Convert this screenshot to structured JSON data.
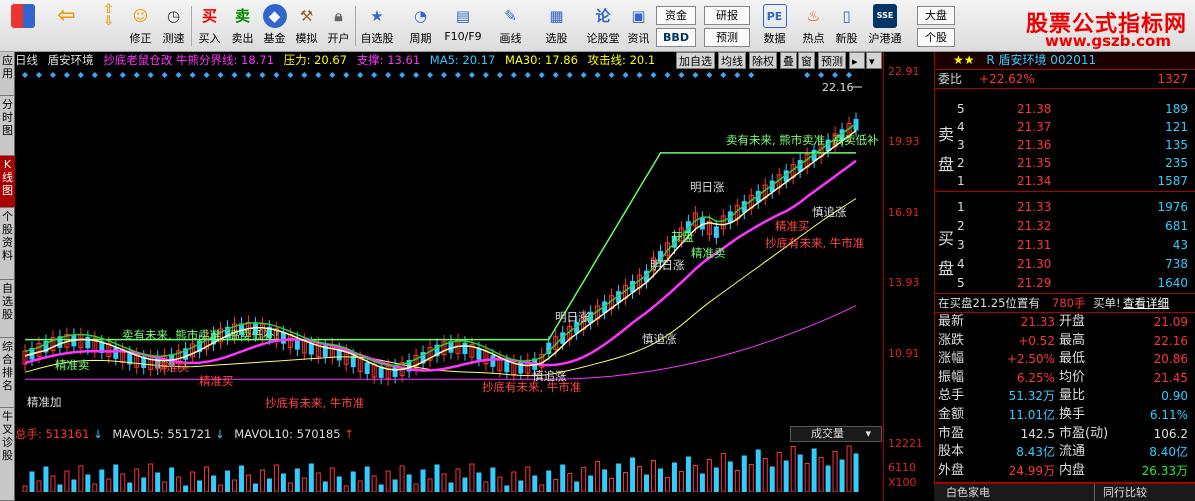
{
  "toolbar": {
    "buttons": [
      {
        "label": "",
        "icon": "grid-icon"
      },
      {
        "label": "",
        "icon": "back-arrow-icon"
      },
      {
        "label": "",
        "icon": "up-down-arrows-icon"
      },
      {
        "label": "修正",
        "icon": "refresh-icon"
      },
      {
        "label": "测速",
        "icon": "clock-icon"
      },
      {
        "label": "买入",
        "icon": "buy-icon",
        "glyph": "买"
      },
      {
        "label": "卖出",
        "icon": "sell-icon",
        "glyph": "卖"
      },
      {
        "label": "基金",
        "icon": "fund-icon"
      },
      {
        "label": "模拟",
        "icon": "hammer-icon"
      },
      {
        "label": "开户",
        "icon": "lock-icon"
      },
      {
        "label": "自选股",
        "icon": "star-list-icon"
      },
      {
        "label": "周期",
        "icon": "period-icon"
      },
      {
        "label": "F10/F9",
        "icon": "f10-icon"
      },
      {
        "label": "画线",
        "icon": "pen-icon"
      },
      {
        "label": "选股",
        "icon": "screen-icon"
      },
      {
        "label": "论股堂",
        "icon": "forum-icon",
        "glyph": "论"
      },
      {
        "label": "资讯",
        "icon": "news-icon"
      },
      {
        "label": "数据",
        "icon": "pe-icon",
        "glyph": "PE"
      },
      {
        "label": "热点",
        "icon": "hot-icon"
      },
      {
        "label": "新股",
        "icon": "new-stock-icon"
      },
      {
        "label": "沪港通",
        "icon": "sse-hkex-icon"
      }
    ],
    "box_zijin": "资金",
    "box_bbd": "BBD",
    "box_yanbao": "研报",
    "box_yuce": "预测",
    "box_dapan": "大盘",
    "box_gegu": "个股"
  },
  "brand": {
    "name": "股票公式指标网",
    "url": "www.gszb.com"
  },
  "left_tabs": [
    "应用",
    "分时图",
    "K线图",
    "个股资料",
    "自选股",
    "综合排名",
    "牛叉诊股"
  ],
  "chart_header": {
    "period": "日线",
    "stock": "盾安环境",
    "indicator": "抄底老鼠仓改 牛熊分界线: 18.71",
    "pressure": "压力: 20.67",
    "support": "支撑: 13.61",
    "ma5": "MA5: 20.17",
    "ma30": "MA30: 17.86",
    "attack": "攻击线: 20.1",
    "buttons": [
      "加自选",
      "均线",
      "除权",
      "叠",
      "窗",
      "预测"
    ]
  },
  "price_axis": [
    "22.91",
    "19.93",
    "16.91",
    "13.93",
    "10.91",
    "12221",
    "6110",
    "X100"
  ],
  "annotations": [
    {
      "text": "22.16",
      "color": "#ddd"
    },
    {
      "text": "卖有未来, 熊市卖准, 高卖低补!",
      "color": "#7f7"
    },
    {
      "text": "卖有未来, 熊市卖准, 高卖低补",
      "color": "#7f7"
    },
    {
      "text": "慎追涨",
      "color": "#ddd"
    },
    {
      "text": "慎追涨",
      "color": "#ddd"
    },
    {
      "text": "慎追涨",
      "color": "#ddd"
    },
    {
      "text": "精准买",
      "color": "#f44"
    },
    {
      "text": "精准买",
      "color": "#f44"
    },
    {
      "text": "精准买",
      "color": "#f44"
    },
    {
      "text": "抄底有未来, 牛市准",
      "color": "#f44"
    },
    {
      "text": "抄底有未来, 牛市准",
      "color": "#f44"
    },
    {
      "text": "抄底有未来, 牛市准",
      "color": "#f44"
    },
    {
      "text": "明日涨",
      "color": "#ddd"
    },
    {
      "text": "明日涨",
      "color": "#ddd"
    },
    {
      "text": "明日涨",
      "color": "#ddd"
    },
    {
      "text": "开盘",
      "color": "#7f7"
    },
    {
      "text": "精准卖",
      "color": "#7f7"
    },
    {
      "text": "精准卖",
      "color": "#7f7"
    },
    {
      "text": "精准加",
      "color": "#ddd"
    }
  ],
  "volume_header": {
    "total": "总手: 513161",
    "mavol5": "MAVOL5: 551721",
    "mavol10": "MAVOL10: 570185"
  },
  "chengjiao_label": "成交量",
  "right_panel": {
    "stock_title": "R 盾安环境 002011",
    "weibi_label": "委比",
    "weibi_value": "+22.62%",
    "weibi_diff": "1327",
    "sell_label": "卖盘",
    "buy_label": "买盘",
    "sell_orders": [
      {
        "level": "5",
        "price": "21.38",
        "vol": "189"
      },
      {
        "level": "4",
        "price": "21.37",
        "vol": "121"
      },
      {
        "level": "3",
        "price": "21.36",
        "vol": "135"
      },
      {
        "level": "2",
        "price": "21.35",
        "vol": "235"
      },
      {
        "level": "1",
        "price": "21.34",
        "vol": "1587"
      }
    ],
    "buy_orders": [
      {
        "level": "1",
        "price": "21.33",
        "vol": "1976"
      },
      {
        "level": "2",
        "price": "21.32",
        "vol": "681"
      },
      {
        "level": "3",
        "price": "21.31",
        "vol": "43"
      },
      {
        "level": "4",
        "price": "21.30",
        "vol": "738"
      },
      {
        "level": "5",
        "price": "21.29",
        "vol": "1640"
      }
    ],
    "notice": "在买盘21.25位置有",
    "notice_vol": "780手",
    "notice_action": "买单!",
    "notice_link": "查看详细",
    "quote": [
      {
        "l1": "最新",
        "v1": "21.33",
        "l2": "开盘",
        "v2": "21.09"
      },
      {
        "l1": "涨跌",
        "v1": "+0.52",
        "l2": "最高",
        "v2": "22.16"
      },
      {
        "l1": "涨幅",
        "v1": "+2.50%",
        "l2": "最低",
        "v2": "20.86"
      },
      {
        "l1": "振幅",
        "v1": "6.25%",
        "l2": "均价",
        "v2": "21.45"
      },
      {
        "l1": "总手",
        "v1": "51.32万",
        "l2": "量比",
        "v2": "0.90"
      },
      {
        "l1": "金额",
        "v1": "11.01亿",
        "l2": "换手",
        "v2": "6.11%"
      },
      {
        "l1": "市盈",
        "v1": "142.5",
        "l2": "市盈(动)",
        "v2": "106.2"
      },
      {
        "l1": "股本",
        "v1": "8.43亿",
        "l2": "流通",
        "v2": "8.40亿"
      },
      {
        "l1": "外盘",
        "v1": "24.99万",
        "l2": "内盘",
        "v2": "26.33万"
      }
    ],
    "bottom_left": "白色家电",
    "bottom_right": "同行比较"
  }
}
